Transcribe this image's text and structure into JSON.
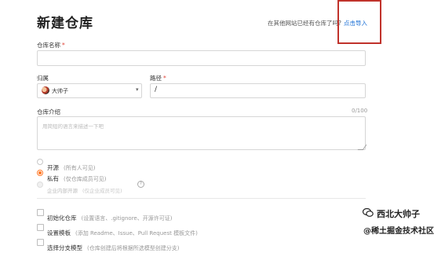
{
  "header": {
    "title": "新建仓库",
    "import_question": "在其他网站已经有仓库了吗?",
    "import_link": "点击导入"
  },
  "repo_name": {
    "label": "仓库名称",
    "required_mark": "*",
    "value": ""
  },
  "owner": {
    "label": "归属",
    "selected": "大帅子"
  },
  "path": {
    "label": "路径",
    "required_mark": "*",
    "value": "/"
  },
  "description": {
    "label": "仓库介绍",
    "counter": "0/100",
    "placeholder": "用简短的语言来描述一下吧"
  },
  "visibility": {
    "options": [
      {
        "label": "开源",
        "note": "(所有人可见)",
        "checked": false,
        "disabled": false
      },
      {
        "label": "私有",
        "note": "(仅仓库成员可见)",
        "checked": true,
        "disabled": false
      },
      {
        "label": "企业内部开源",
        "note": "(仅企业成员可见)",
        "checked": false,
        "disabled": true
      }
    ]
  },
  "init_options": [
    {
      "label": "初始化仓库",
      "note": "(设置语言、.gitignore、开源许可证)"
    },
    {
      "label": "设置模板",
      "note": "(添加 Readme、Issue、Pull Request 模板文件)"
    },
    {
      "label": "选择分支模型",
      "note": "(仓库创建后将根据所选模型创建分支)"
    }
  ],
  "watermark": {
    "line1": "西北大帅子",
    "line2": "@稀土掘金技术社区"
  },
  "colors": {
    "accent": "#ff7a29",
    "link": "#1a6fd6",
    "required": "#e0463b",
    "highlight_box": "#c0322b"
  }
}
